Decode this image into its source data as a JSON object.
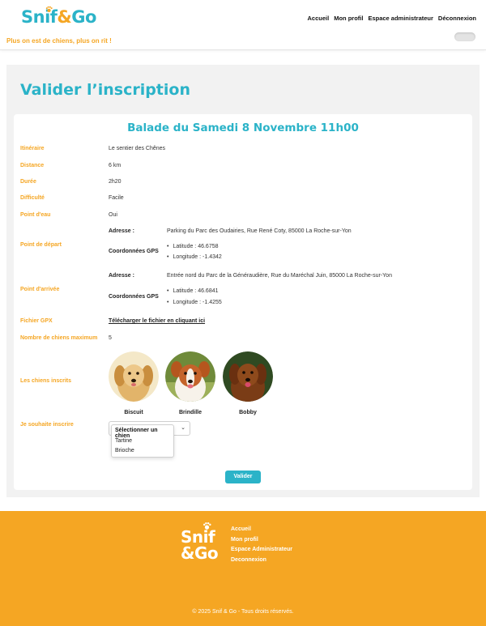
{
  "header": {
    "logo_snif": "Snif",
    "logo_amp": "&",
    "logo_go": "Go",
    "slogan": "Plus on est de chiens, plus on rit !",
    "nav": [
      "Accueil",
      "Mon profil",
      "Espace administrateur",
      "Déconnexion"
    ],
    "toggle_on": false
  },
  "page": {
    "title": "Valider l’inscription"
  },
  "event": {
    "title": "Balade du Samedi 8 Novembre 11h00",
    "fields": {
      "itineraire": {
        "label": "Itinéraire",
        "value": "Le sentier des Chênes"
      },
      "distance": {
        "label": "Distance",
        "value": "6 km"
      },
      "duree": {
        "label": "Durée",
        "value": "2h20"
      },
      "difficulte": {
        "label": "Difficulté",
        "value": "Facile"
      },
      "point_eau": {
        "label": "Point d'eau",
        "value": "Oui"
      }
    },
    "depart": {
      "label": "Point de départ",
      "address_label": "Adresse :",
      "address": "Parking du Parc des Oudairies, Rue René Coty, 85000 La Roche-sur-Yon",
      "gps_label": "Coordonnées GPS",
      "latitude": "Latitude : 46.6758",
      "longitude": "Longitude : -1.4342"
    },
    "arrivee": {
      "label": "Point d'arrivée",
      "address_label": "Adresse :",
      "address": "Entrée nord du Parc de la Généraudière, Rue du Maréchal Juin, 85000 La Roche-sur-Yon",
      "gps_label": "Coordonnées GPS",
      "latitude": "Latitude : 46.6841",
      "longitude": "Longitude : -1.4255"
    },
    "gpx": {
      "label": "Fichier GPX",
      "link": "Télécharger le fichier en cliquant ici"
    },
    "max_dogs": {
      "label": "Nombre de chiens maximum",
      "value": "5"
    },
    "registered": {
      "label": "Les chiens inscrits",
      "dogs": [
        {
          "name": "Biscuit",
          "icon": "golden-retriever-photo"
        },
        {
          "name": "Brindille",
          "icon": "border-collie-photo"
        },
        {
          "name": "Bobby",
          "icon": "red-retriever-photo"
        }
      ]
    },
    "register": {
      "label": "Je souhaite inscrire",
      "select_placeholder": "Sélectionner un chien",
      "options": [
        "Sélectionner un chien",
        "Tartine",
        "Brioche"
      ]
    },
    "submit_label": "Valider"
  },
  "footer": {
    "logo_line1": "Snif",
    "logo_line2": "&Go",
    "links": [
      "Accueil",
      "Mon profil",
      "Espace Administrateur",
      "Deconnexion"
    ],
    "copyright": "© 2025 Snif & Go - Tous droits réservés."
  },
  "colors": {
    "primary": "#2bb3c8",
    "accent": "#f5a623"
  }
}
